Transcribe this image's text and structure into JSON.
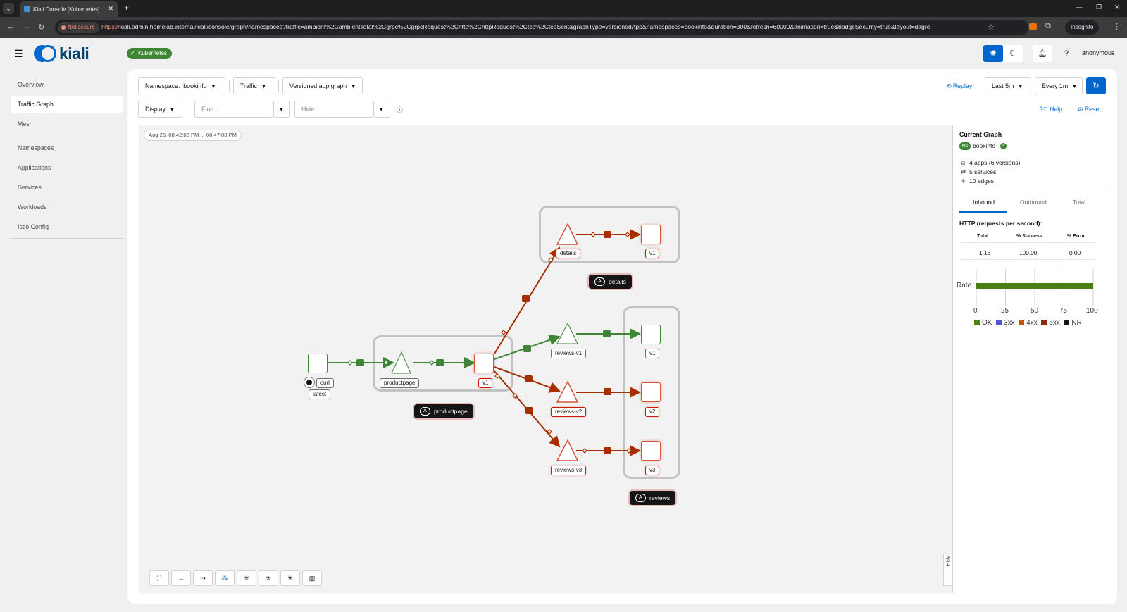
{
  "browser": {
    "tab_title": "Kiali Console [Kubernetes]",
    "not_secure": "Not secure",
    "url_scheme": "https://",
    "url_rest": "kiali.admin.homelab.internal/kiali/console/graph/namespaces?traffic=ambient%2CambientTotal%2Cgrpc%2CgrpcRequest%2Chttp%2ChttpRequest%2Ctcp%2CtcpSent&graphType=versionedApp&namespaces=bookinfo&duration=300&refresh=60000&animation=true&badgeSecurity=true&layout=dagre",
    "incognito": "Incognito"
  },
  "header": {
    "logo_text": "kiali",
    "cluster_badge": "Kubernetes",
    "user": "anonymous"
  },
  "sidebar": {
    "items": [
      {
        "label": "Overview"
      },
      {
        "label": "Traffic Graph"
      },
      {
        "label": "Mesh"
      },
      {
        "label": "Namespaces"
      },
      {
        "label": "Applications"
      },
      {
        "label": "Services"
      },
      {
        "label": "Workloads"
      },
      {
        "label": "Istio Config"
      }
    ]
  },
  "toolbar": {
    "namespace_label": "Namespace:",
    "namespace_value": "bookinfo",
    "traffic": "Traffic",
    "graph_type": "Versioned app graph",
    "replay": "Replay",
    "duration": "Last 5m",
    "refresh": "Every 1m",
    "display": "Display",
    "find_placeholder": "Find...",
    "hide_placeholder": "Hide...",
    "help": "Help",
    "reset": "Reset"
  },
  "graph": {
    "timestamp": "Aug 25, 08:42:08 PM ... 08:47:08 PM",
    "nodes": {
      "curl": "curl",
      "curl_version": "latest",
      "productpage": "productpage",
      "productpage_v1": "v1",
      "details": "details",
      "details_v1": "v1",
      "reviews_v1": "reviews-v1",
      "reviews_v2": "reviews-v2",
      "reviews_v3": "reviews-v3",
      "reviews_app_v1": "v1",
      "reviews_app_v2": "v2",
      "reviews_app_v3": "v3"
    },
    "app_boxes": {
      "productpage": "productpage",
      "details": "details",
      "reviews": "reviews",
      "badge": "A"
    },
    "hide_tab": "Hide"
  },
  "side_panel": {
    "title": "Current Graph",
    "namespace_badge": "NS",
    "namespace": "bookinfo",
    "apps": "4 apps (6 versions)",
    "services": "5 services",
    "edges": "10 edges",
    "tabs": [
      "Inbound",
      "Outbound",
      "Total"
    ],
    "http_title": "HTTP (requests per second):",
    "table": {
      "headers": [
        "Total",
        "% Success",
        "% Error"
      ],
      "values": [
        "1.16",
        "100.00",
        "0.00"
      ]
    },
    "rate_chart": {
      "label": "Rate",
      "ok_percent": 100,
      "ticks": [
        "0",
        "25",
        "50",
        "75",
        "100"
      ],
      "legend": [
        {
          "label": "OK",
          "color": "#4b7f13"
        },
        {
          "label": "3xx",
          "color": "#5752d1"
        },
        {
          "label": "4xx",
          "color": "#c9540b"
        },
        {
          "label": "5xx",
          "color": "#8a2a0c"
        },
        {
          "label": "NR",
          "color": "#151515"
        }
      ]
    }
  },
  "colors": {
    "accent": "#0066cc",
    "healthy_edge": "#3e8635",
    "degraded_edge": "#a82e00",
    "success": "#3e8635"
  }
}
